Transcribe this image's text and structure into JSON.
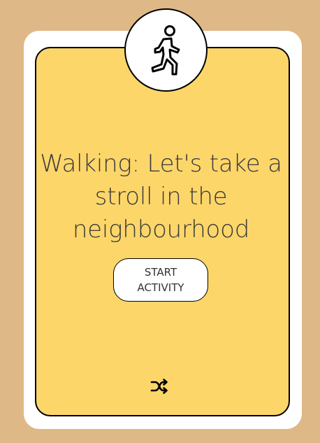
{
  "activity": {
    "title": "Walking: Let's take a stroll in the neighbourhood",
    "icon": "walking-person-icon"
  },
  "actions": {
    "start_label": "START ACTIVITY",
    "shuffle_icon": "shuffle-icon"
  },
  "colors": {
    "background": "#deb887",
    "card_outer": "#ffffff",
    "card_inner": "#fdd66a",
    "border": "#000000"
  }
}
